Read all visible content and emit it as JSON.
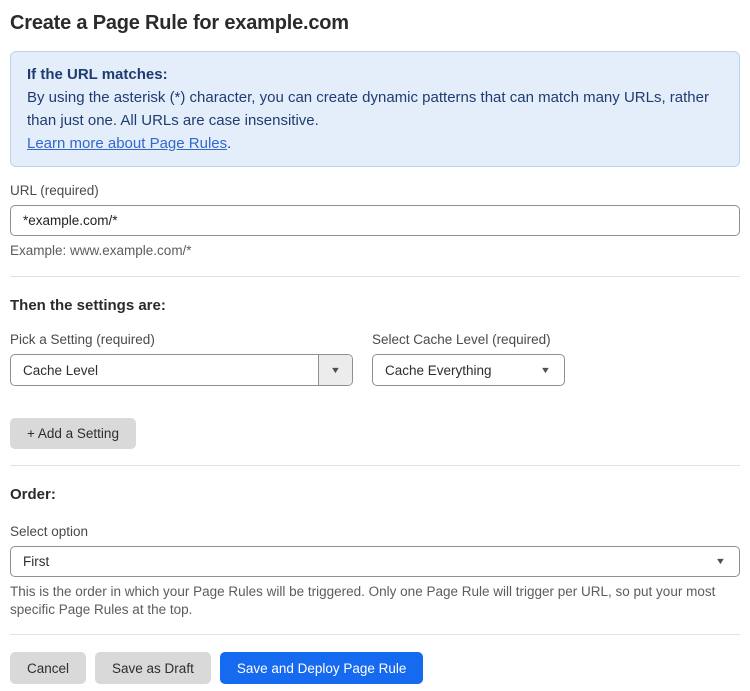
{
  "page": {
    "title": "Create a Page Rule for example.com"
  },
  "info_box": {
    "heading": "If the URL matches:",
    "body": "By using the asterisk (*) character, you can create dynamic patterns that can match many URLs, rather than just one. All URLs are case insensitive.",
    "link_label": "Learn more about Page Rules",
    "link_suffix": "."
  },
  "url_field": {
    "label": "URL (required)",
    "value": "*example.com/*",
    "helper": "Example: www.example.com/*"
  },
  "settings": {
    "heading": "Then the settings are:",
    "setting_picker": {
      "label": "Pick a Setting (required)",
      "selected": "Cache Level"
    },
    "cache_level_picker": {
      "label": "Select Cache Level (required)",
      "selected": "Cache Everything"
    },
    "add_setting_label": "+ Add a Setting"
  },
  "order": {
    "heading": "Order:",
    "label": "Select option",
    "selected": "First",
    "helper": "This is the order in which your Page Rules will be triggered. Only one Page Rule will trigger per URL, so put your most specific Page Rules at the top."
  },
  "actions": {
    "cancel": "Cancel",
    "save_draft": "Save as Draft",
    "save_deploy": "Save and Deploy Page Rule"
  },
  "icons": {
    "dropdown_arrow": "▼"
  },
  "colors": {
    "accent_blue": "#166af0",
    "info_bg": "#e4eefb",
    "info_border": "#b9d4f2",
    "info_text": "#1f3c70",
    "link_blue": "#3367cc",
    "button_gray": "#d9d9d9",
    "input_border": "#8f8f8f"
  }
}
